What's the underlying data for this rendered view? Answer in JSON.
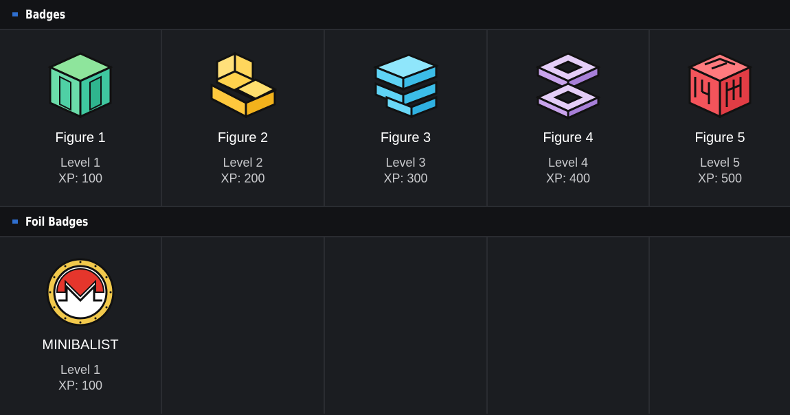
{
  "sections": {
    "badges": {
      "title": "Badges",
      "items": [
        {
          "name": "Figure 1",
          "level": "Level 1",
          "xp": "XP: 100",
          "icon": "green-block-icon",
          "color": "#3fc7a0"
        },
        {
          "name": "Figure 2",
          "level": "Level 2",
          "xp": "XP: 200",
          "icon": "yellow-block-icon",
          "color": "#ffc83d"
        },
        {
          "name": "Figure 3",
          "level": "Level 3",
          "xp": "XP: 300",
          "icon": "blue-block-icon",
          "color": "#5fd3f5"
        },
        {
          "name": "Figure 4",
          "level": "Level 4",
          "xp": "XP: 400",
          "icon": "purple-block-icon",
          "color": "#c9a4ec"
        },
        {
          "name": "Figure 5",
          "level": "Level 5",
          "xp": "XP: 500",
          "icon": "red-block-icon",
          "color": "#f4545b"
        }
      ]
    },
    "foil": {
      "title": "Foil Badges",
      "items": [
        {
          "name": "MINIBALIST",
          "level": "Level 1",
          "xp": "XP: 100",
          "icon": "monero-coin-icon",
          "color": "#f2c94c"
        }
      ]
    }
  },
  "colors": {
    "marker": "#2f6fd0",
    "background": "#1b1d21",
    "header_background": "#121316"
  }
}
